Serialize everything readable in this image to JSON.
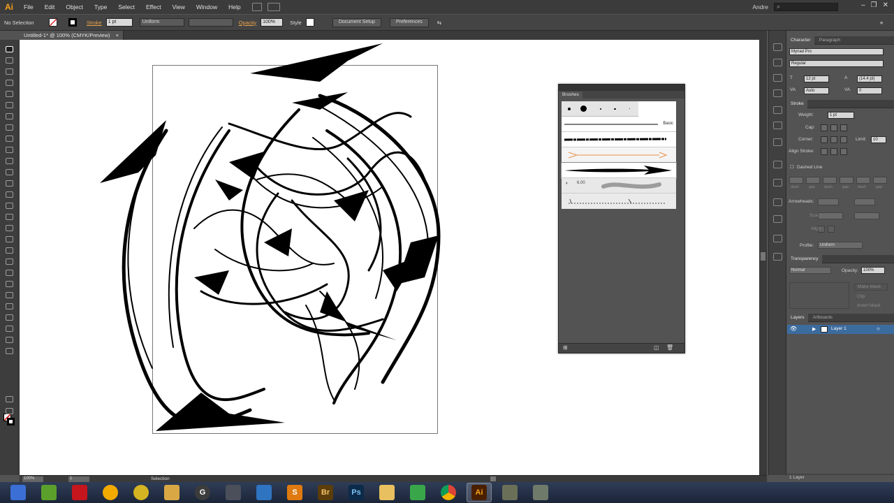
{
  "app": {
    "logo": "Ai",
    "menus": [
      "File",
      "Edit",
      "Object",
      "Type",
      "Select",
      "Effect",
      "View",
      "Window",
      "Help"
    ],
    "user": "Andre",
    "search_placeholder": ""
  },
  "controlbar": {
    "selection": "No Selection",
    "stroke_label": "Stroke",
    "stroke_weight": "1 pt",
    "uniform": "Uniform",
    "opacity_label": "Opacity",
    "opacity_value": "100%",
    "style_label": "Style",
    "document_setup": "Document Setup",
    "preferences": "Preferences"
  },
  "document": {
    "tab_title": "Untitled-1* @ 100% (CMYK/Preview)"
  },
  "brushes": {
    "title": "Brushes",
    "basic": "Basic",
    "size_readout": "6.00"
  },
  "panels": {
    "character": {
      "tab": "Character",
      "tab2": "Paragraph",
      "font": "Myriad Pro",
      "style": "Regular",
      "size": "12 pt",
      "leading": "(14.4 pt)",
      "tracking": "Auto",
      "kerning": "0"
    },
    "stroke": {
      "tab": "Stroke",
      "weight_label": "Weight:",
      "weight": "1 pt",
      "cap_label": "Cap:",
      "corner_label": "Corner:",
      "limit_label": "Limit:",
      "limit": "10",
      "align_label": "Align Stroke:",
      "dashed_label": "Dashed Line",
      "dash_labels": [
        "dash",
        "gap",
        "dash",
        "gap",
        "dash",
        "gap"
      ],
      "arrowheads_label": "Arrowheads:",
      "scale_label": "Scale:",
      "align2_label": "Align:",
      "profile_label": "Profile:",
      "profile": "Uniform"
    },
    "transparency": {
      "tab": "Transparency",
      "mode": "Normal",
      "opacity_label": "Opacity:",
      "opacity": "100%",
      "make_mask": "Make Mask",
      "clip": "Clip",
      "invert": "Invert Mask"
    },
    "layers": {
      "tab": "Layers",
      "tab2": "Artboards",
      "layer_name": "Layer 1",
      "count": "1 Layer"
    }
  },
  "status": {
    "zoom": "100%",
    "page": "1",
    "tool": "Selection"
  },
  "taskbar": {
    "apps": [
      {
        "name": "save-app",
        "label": "",
        "color": "#3b6fd6"
      },
      {
        "name": "feather-app",
        "label": "",
        "color": "#5ca02c"
      },
      {
        "name": "flash-app",
        "label": "",
        "color": "#c4161c"
      },
      {
        "name": "duck-app",
        "label": "",
        "color": "#f2a900"
      },
      {
        "name": "media-app",
        "label": "",
        "color": "#d4b422"
      },
      {
        "name": "folder-edit-app",
        "label": "",
        "color": "#d9a845"
      },
      {
        "name": "g-app",
        "label": "G",
        "color": "#3c3c3c"
      },
      {
        "name": "mac-app",
        "label": "",
        "color": "#4a4f5a"
      },
      {
        "name": "network-app",
        "label": "",
        "color": "#2f74c0"
      },
      {
        "name": "stamp-app",
        "label": "S",
        "color": "#e07a10"
      },
      {
        "name": "bridge-app",
        "label": "Br",
        "color": "#5a3d0a"
      },
      {
        "name": "photoshop-app",
        "label": "Ps",
        "color": "#0c2a4a"
      },
      {
        "name": "explorer-app",
        "label": "",
        "color": "#e8c060"
      },
      {
        "name": "git-app",
        "label": "",
        "color": "#3aa64a"
      },
      {
        "name": "chrome-app",
        "label": "",
        "color": "#e0a020"
      },
      {
        "name": "illustrator-app",
        "label": "Ai",
        "color": "#4a1f00"
      },
      {
        "name": "tools-app",
        "label": "",
        "color": "#6a7058"
      },
      {
        "name": "shapes-app",
        "label": "",
        "color": "#707a6a"
      }
    ]
  },
  "colors": {
    "accent": "#f7a21b",
    "layer_highlight": "#3c6b9e",
    "stroke_label": "#e8a14a"
  }
}
